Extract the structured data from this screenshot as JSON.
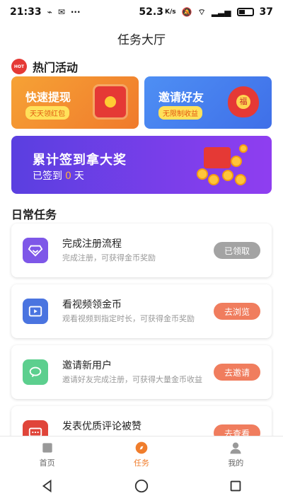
{
  "status_bar": {
    "time": "21:33",
    "network_speed": "52.3",
    "network_unit": "K/s",
    "battery": "37"
  },
  "header": {
    "title": "任务大厅"
  },
  "hot_section": {
    "badge": "HOT",
    "title": "热门活动",
    "cards": [
      {
        "title": "快速提现",
        "tag": "天天领红包"
      },
      {
        "title": "邀请好友",
        "tag": "无限制收益"
      }
    ]
  },
  "banner": {
    "title": "累计签到拿大奖",
    "sub_prefix": "已签到",
    "days": "0",
    "sub_suffix": "天"
  },
  "daily_section": {
    "title": "日常任务",
    "tasks": [
      {
        "title": "完成注册流程",
        "desc": "完成注册，可获得金币奖励",
        "button": "已领取",
        "icon": "diamond-icon",
        "color": "#7e57e8"
      },
      {
        "title": "看视频领金币",
        "desc": "观看视频到指定时长，可获得金币奖励",
        "button": "去浏览",
        "icon": "video-icon",
        "color": "#4a74e0"
      },
      {
        "title": "邀请新用户",
        "desc": "邀请好友完成注册，可获得大量金币收益",
        "button": "去邀请",
        "icon": "chat-icon",
        "color": "#5ccf8e"
      },
      {
        "title": "发表优质评论被赞",
        "desc": "",
        "button": "去查看",
        "icon": "comment-icon",
        "color": "#e0453a"
      }
    ]
  },
  "bottom_nav": {
    "items": [
      {
        "label": "首页",
        "icon": "home-icon"
      },
      {
        "label": "任务",
        "icon": "compass-icon"
      },
      {
        "label": "我的",
        "icon": "user-icon"
      }
    ],
    "active_color": "#f07d2c"
  }
}
